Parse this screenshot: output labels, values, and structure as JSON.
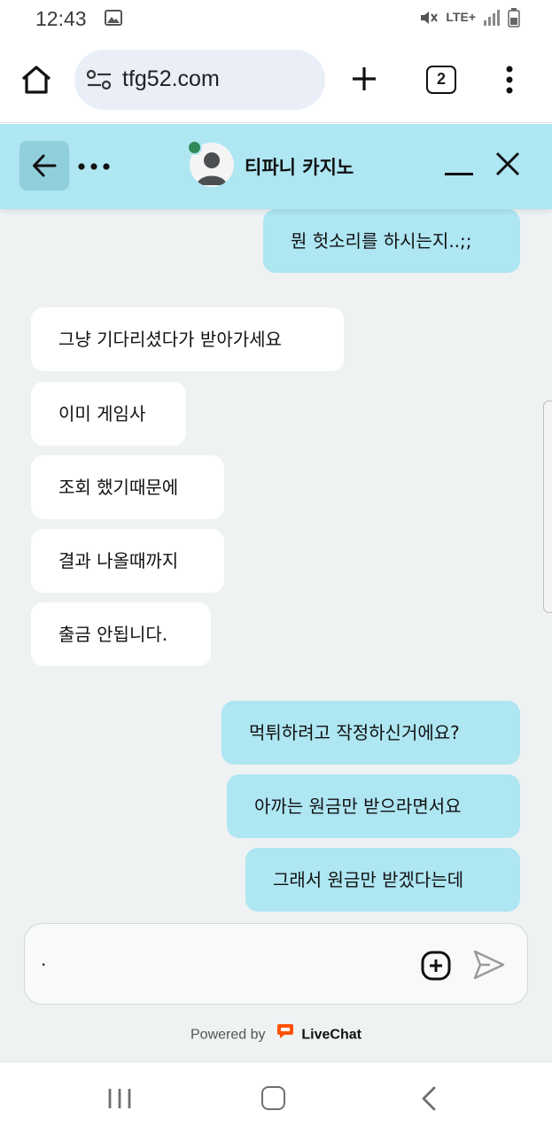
{
  "status_bar": {
    "time": "12:43",
    "network": "LTE+",
    "icons": [
      "image-icon",
      "mute-icon",
      "signal-icon",
      "battery-icon"
    ]
  },
  "browser": {
    "url": "tfg52.com",
    "tab_count": "2",
    "icons": [
      "home-icon",
      "site-settings-icon",
      "new-tab-icon",
      "tabs-icon",
      "menu-icon"
    ]
  },
  "chat_header": {
    "agent_name": "티파니 카지노",
    "agent_status": "online",
    "icons": [
      "back-arrow-icon",
      "more-icon",
      "minimize-icon",
      "close-icon"
    ]
  },
  "messages": [
    {
      "from": "visitor",
      "text": "뭔 헛소리를 하시는지..;;"
    },
    {
      "from": "agent",
      "text": "그냥 기다리셨다가 받아가세요"
    },
    {
      "from": "agent",
      "text": "이미 게임사"
    },
    {
      "from": "agent",
      "text": "조회 했기때문에"
    },
    {
      "from": "agent",
      "text": "결과 나올때까지"
    },
    {
      "from": "agent",
      "text": "출금 안됩니다."
    },
    {
      "from": "visitor",
      "text": "먹튀하려고 작정하신거에요?"
    },
    {
      "from": "visitor",
      "text": "아까는 원금만 받으라면서요"
    },
    {
      "from": "visitor",
      "text": "그래서 원금만 받겠다는데"
    }
  ],
  "composer": {
    "value": ".",
    "icons": [
      "attach-plus-icon",
      "send-icon"
    ]
  },
  "footer": {
    "powered_by": "Powered by",
    "brand": "LiveChat"
  },
  "colors": {
    "header_bg": "#aee6f2",
    "visitor_bubble": "#aee6f2",
    "agent_bubble": "#ffffff",
    "chat_bg": "#eef2f3",
    "online": "#2e8a57",
    "livechat_orange": "#ff5100"
  }
}
